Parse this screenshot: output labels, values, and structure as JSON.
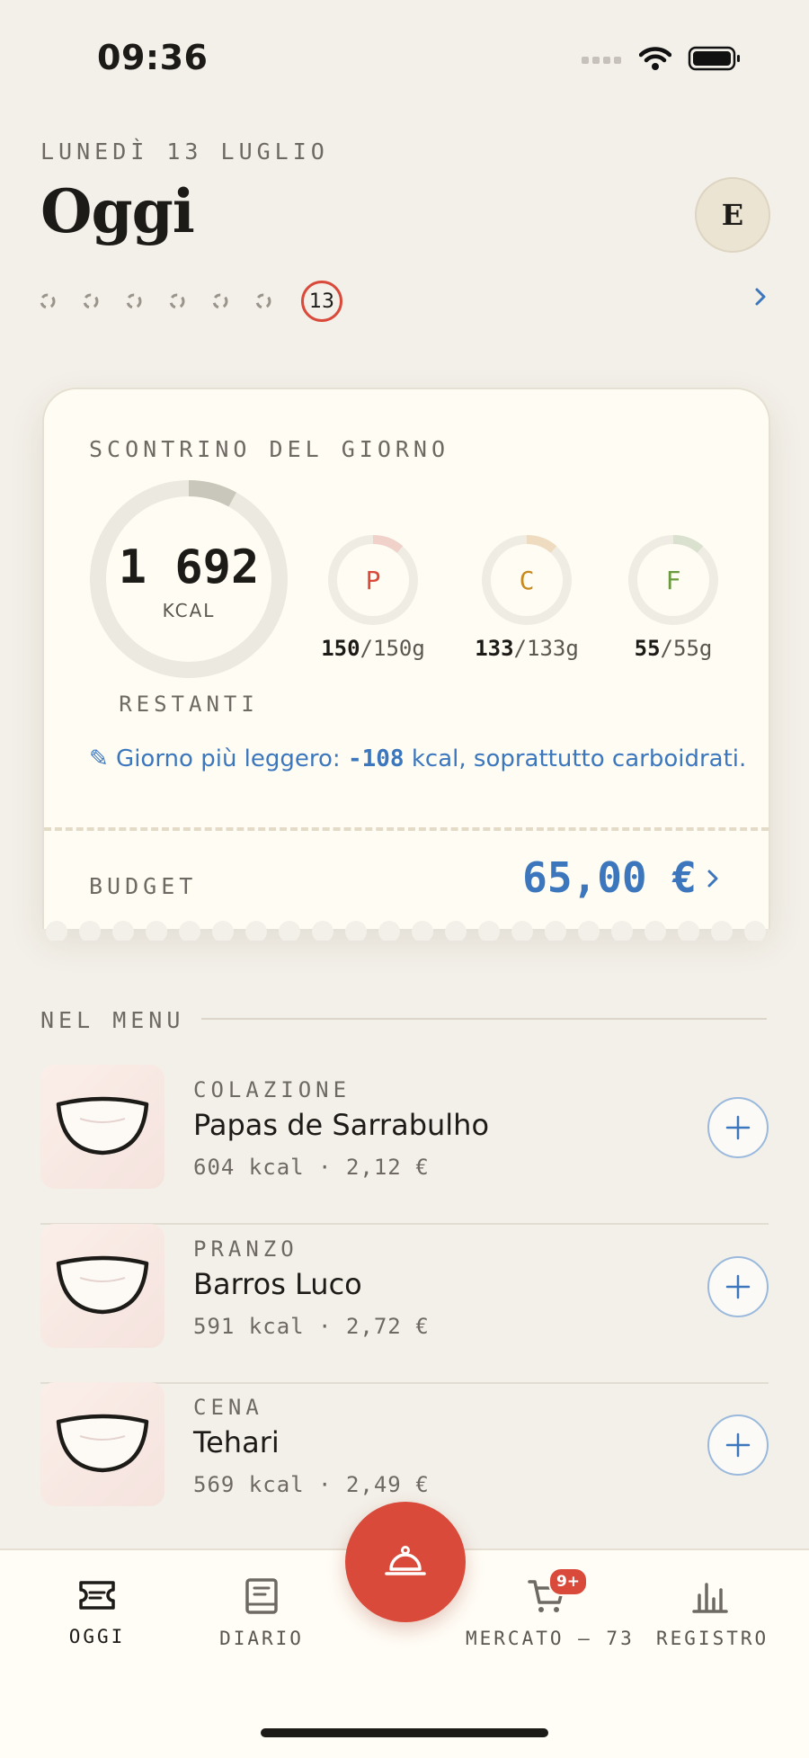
{
  "status_bar": {
    "time": "09:36"
  },
  "header": {
    "date": "LUNEDÌ 13 LUGLIO",
    "title": "Oggi",
    "avatar_initial": "E",
    "today_number": "13"
  },
  "receipt": {
    "label": "SCONTRINO DEL GIORNO",
    "kcal_value": "1 692",
    "kcal_unit": "KCAL",
    "kcal_caption": "RESTANTI",
    "kcal_used_fraction": 0.08,
    "macros": [
      {
        "letter": "P",
        "current": "150",
        "target": "/150g",
        "color": "#d94a3a",
        "track": "#f0d2ca"
      },
      {
        "letter": "C",
        "current": "133",
        "target": "/133g",
        "color": "#c98a1d",
        "track": "#efdcc0"
      },
      {
        "letter": "F",
        "current": "55",
        "target": "/55g",
        "color": "#6a9a3e",
        "track": "#dbe1cf"
      }
    ],
    "note_prefix": "✎ Giorno più leggero: ",
    "note_value": "-108",
    "note_suffix": " kcal, soprattutto carboidrati.",
    "budget_label": "BUDGET",
    "budget_value": "65,00 €"
  },
  "menu": {
    "section_label": "NEL MENU",
    "items": [
      {
        "type": "COLAZIONE",
        "name": "Papas de Sarrabulho",
        "meta": "604 kcal · 2,12 €"
      },
      {
        "type": "PRANZO",
        "name": "Barros Luco",
        "meta": "591 kcal · 2,72 €"
      },
      {
        "type": "CENA",
        "name": "Tehari",
        "meta": "569 kcal · 2,49 €"
      }
    ]
  },
  "tabbar": {
    "tabs": [
      {
        "label": "OGGI",
        "icon": "ticket-icon"
      },
      {
        "label": "DIARIO",
        "icon": "book-icon"
      },
      {
        "label": "MERCATO — 73",
        "icon": "cart-icon"
      },
      {
        "label": "REGISTRO",
        "icon": "bar-chart-icon"
      }
    ],
    "cart_badge": "9+",
    "fab_icon": "cloche-icon"
  },
  "colors": {
    "accent_red": "#d94a3a",
    "accent_blue": "#3c77be",
    "background": "#f3f0e9",
    "card": "#fffdf3"
  }
}
